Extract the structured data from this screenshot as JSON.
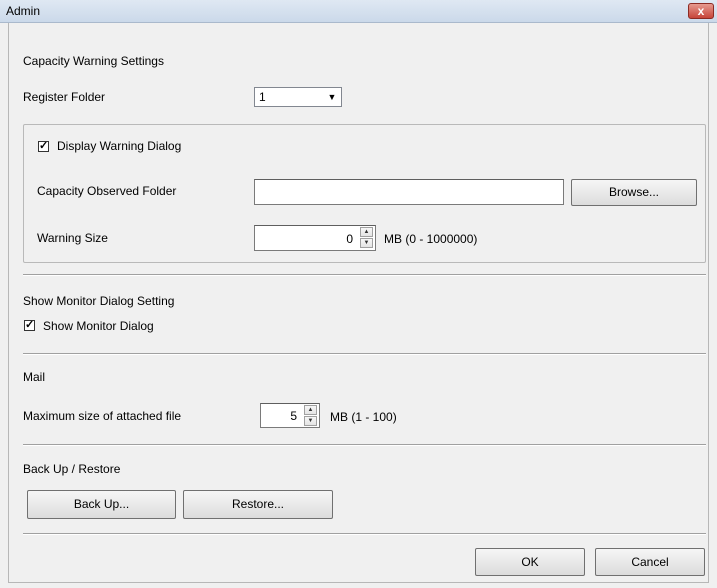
{
  "window": {
    "title": "Admin",
    "close_glyph": "x"
  },
  "capacity": {
    "section_title": "Capacity Warning Settings",
    "register_folder_label": "Register Folder",
    "register_folder_value": "1",
    "display_warning_label": "Display Warning Dialog",
    "display_warning_checked": true,
    "observed_folder_label": "Capacity Observed Folder",
    "observed_folder_value": "",
    "browse_label": "Browse...",
    "warning_size_label": "Warning Size",
    "warning_size_value": "0",
    "warning_size_range": "MB (0 - 1000000)"
  },
  "monitor": {
    "section_title": "Show Monitor Dialog Setting",
    "show_monitor_label": "Show Monitor Dialog",
    "show_monitor_checked": true
  },
  "mail": {
    "section_title": "Mail",
    "max_size_label": "Maximum size of attached file",
    "max_size_value": "5",
    "max_size_range": "MB (1 - 100)"
  },
  "backup": {
    "section_title": "Back Up / Restore",
    "backup_label": "Back Up...",
    "restore_label": "Restore..."
  },
  "footer": {
    "ok_label": "OK",
    "cancel_label": "Cancel"
  },
  "icons": {
    "dropdown": "chevron-down-icon",
    "check": "checkmark-icon",
    "close": "close-icon"
  }
}
